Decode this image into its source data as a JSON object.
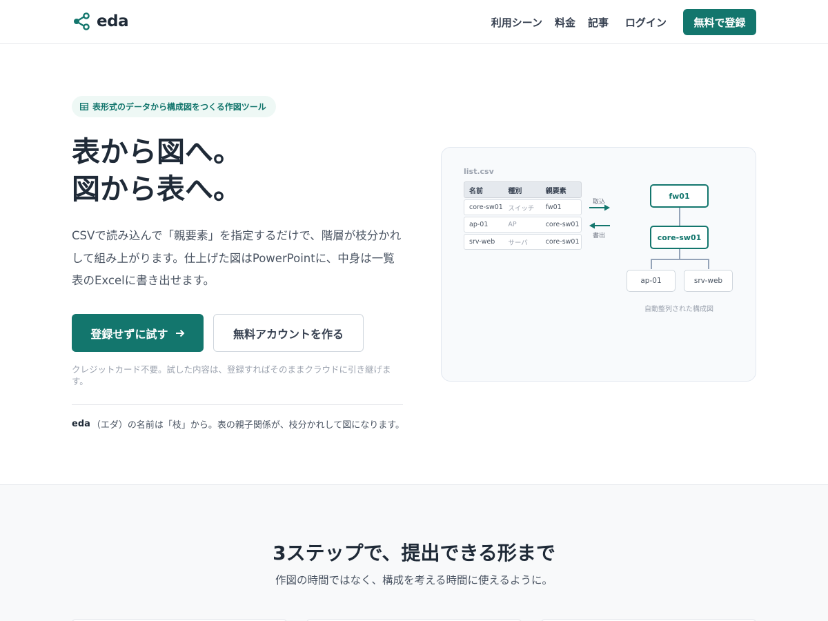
{
  "header": {
    "logo_text": "eda",
    "nav": [
      "利用シーン",
      "料金",
      "記事"
    ],
    "login": "ログイン",
    "signup": "無料で登録"
  },
  "hero": {
    "badge": "表形式のデータから構成図をつくる作図ツール",
    "title_line1": "表から図へ。",
    "title_line2": "図から表へ。",
    "description": "CSVで読み込んで「親要素」を指定するだけで、階層が枝分かれして組み上がります。仕上げた図はPowerPointに、中身は一覧表のExcelに書き出せます。",
    "primary_button": "登録せずに試す",
    "secondary_button": "無料アカウントを作る",
    "note": "クレジットカード不要。試した内容は、登録すればそのままクラウドに引き継げます。",
    "footnote_brand": "eda",
    "footnote_text": "（エダ）の名前は「枝」から。表の親子関係が、枝分かれして図になります。"
  },
  "diagram": {
    "file_name": "list.csv",
    "columns": [
      "名前",
      "種別",
      "親要素"
    ],
    "rows": [
      [
        "core-sw01",
        "スイッチ",
        "fw01"
      ],
      [
        "ap-01",
        "AP",
        "core-sw01"
      ],
      [
        "srv-web",
        "サーバ",
        "core-sw01"
      ]
    ],
    "import_label": "取込",
    "export_label": "書出",
    "nodes": {
      "root": "fw01",
      "middle": "core-sw01",
      "leaf1": "ap-01",
      "leaf2": "srv-web"
    },
    "caption": "自動整列された構成図"
  },
  "section2": {
    "title": "3ステップで、提出できる形まで",
    "subtitle": "作図の時間ではなく、構成を考える時間に使えるように。"
  },
  "colors": {
    "accent": "#13766d",
    "badge_bg": "#eef8f5",
    "panel_bg": "#f8fafc"
  }
}
